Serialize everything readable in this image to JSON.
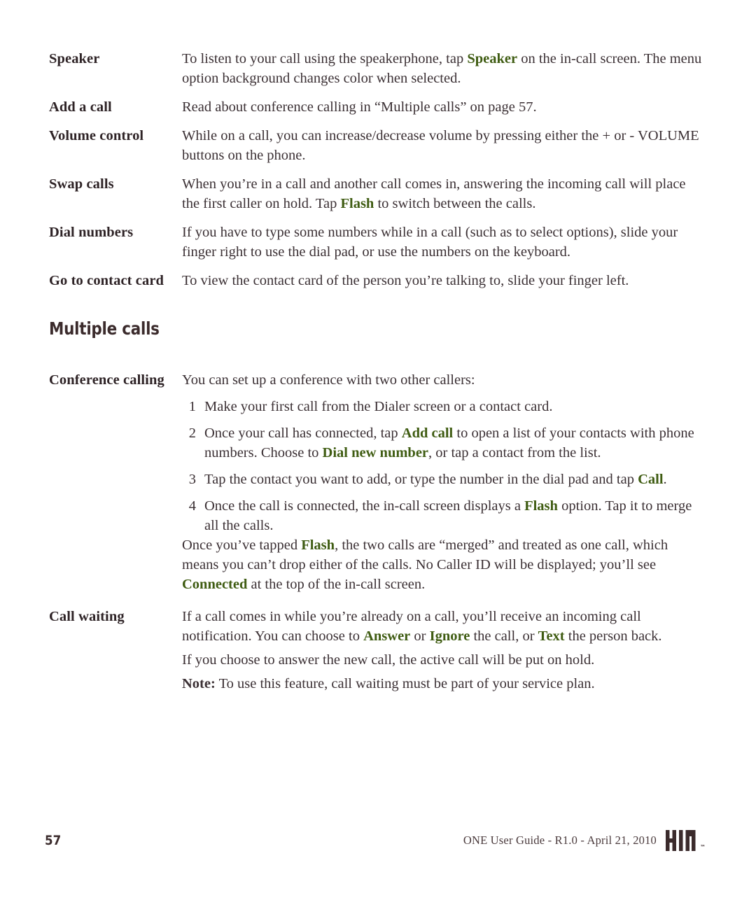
{
  "document": {
    "colors": {
      "body_text": "#3b3034",
      "label_text": "#2e2326",
      "accent_green": "#3f5c12",
      "heading": "#3b2b2c",
      "background": "#ffffff"
    }
  },
  "entries": [
    {
      "label": "Speaker",
      "lines": [
        {
          "segments": [
            {
              "text": "To listen to your call using the speakerphone, tap ",
              "style": "normal"
            },
            {
              "text": "Speaker",
              "style": "green"
            },
            {
              "text": " on the in-call screen. The menu option background changes color when selected.",
              "style": "normal"
            }
          ]
        }
      ]
    },
    {
      "label": "Add a call",
      "lines": [
        {
          "segments": [
            {
              "text": "Read about conference calling in “Multiple calls” on page 57.",
              "style": "normal"
            }
          ]
        }
      ]
    },
    {
      "label": "Volume control",
      "lines": [
        {
          "segments": [
            {
              "text": "While on a call, you can increase/decrease volume by pressing either the + or - VOLUME buttons on the phone.",
              "style": "normal"
            }
          ]
        }
      ]
    },
    {
      "label": "Swap calls",
      "lines": [
        {
          "segments": [
            {
              "text": "When you’re in a call and another call comes in, answering the incoming call will place the first caller on hold. Tap ",
              "style": "normal"
            },
            {
              "text": "Flash",
              "style": "green"
            },
            {
              "text": " to switch between the calls.",
              "style": "normal"
            }
          ]
        }
      ]
    },
    {
      "label": "Dial numbers",
      "lines": [
        {
          "segments": [
            {
              "text": "If you have to type some numbers while in a call (such as to select options), slide your finger right to use the dial pad, or use the numbers on the keyboard.",
              "style": "normal"
            }
          ]
        }
      ]
    },
    {
      "label": "Go to contact card",
      "lines": [
        {
          "segments": [
            {
              "text": "To view the contact card of the person you’re talking to, slide your finger left.",
              "style": "normal"
            }
          ]
        }
      ]
    }
  ],
  "section": {
    "heading": "Multiple calls",
    "conference": {
      "label": "Conference calling",
      "intro": "You can set up a conference with two other callers:",
      "steps": [
        {
          "number": "1",
          "segments": [
            {
              "text": "Make your first call from the Dialer screen or a contact card.",
              "style": "normal"
            }
          ]
        },
        {
          "number": "2",
          "segments": [
            {
              "text": "Once your call has connected, tap ",
              "style": "normal"
            },
            {
              "text": "Add call",
              "style": "green"
            },
            {
              "text": " to open a list of your contacts with phone numbers. Choose to ",
              "style": "normal"
            },
            {
              "text": "Dial new number",
              "style": "green"
            },
            {
              "text": ", or tap a contact from the list.",
              "style": "normal"
            }
          ]
        },
        {
          "number": "3",
          "segments": [
            {
              "text": "Tap the contact you want to add, or type the number in the dial pad and tap ",
              "style": "normal"
            },
            {
              "text": "Call",
              "style": "green"
            },
            {
              "text": ".",
              "style": "normal"
            }
          ]
        },
        {
          "number": "4",
          "segments": [
            {
              "text": "Once the call is connected, the in-call screen displays a ",
              "style": "normal"
            },
            {
              "text": "Flash",
              "style": "green"
            },
            {
              "text": " option. Tap it to merge all the calls.",
              "style": "normal"
            }
          ]
        }
      ],
      "closing": [
        {
          "text": "Once you’ve tapped ",
          "style": "normal"
        },
        {
          "text": "Flash",
          "style": "green"
        },
        {
          "text": ", the two calls are “merged” and treated as one call, which means you can’t drop either of the calls. No Caller ID will be displayed; you’ll see ",
          "style": "normal"
        },
        {
          "text": "Connected",
          "style": "green"
        },
        {
          "text": " at the top of the in-call screen.",
          "style": "normal"
        }
      ]
    },
    "call_waiting": {
      "label": "Call waiting",
      "paragraphs": [
        [
          {
            "text": "If a call comes in while you’re already on a call, you’ll receive an incoming call notification. You can choose to ",
            "style": "normal"
          },
          {
            "text": "Answer",
            "style": "green"
          },
          {
            "text": " or ",
            "style": "normal"
          },
          {
            "text": "Ignore",
            "style": "green"
          },
          {
            "text": " the call, or ",
            "style": "normal"
          },
          {
            "text": "Text",
            "style": "green"
          },
          {
            "text": " the person back.",
            "style": "normal"
          }
        ],
        [
          {
            "text": "If you choose to answer the new call, the active call will be put on hold.",
            "style": "normal"
          }
        ],
        [
          {
            "text": "Note:",
            "style": "bold"
          },
          {
            "text": " To use this feature, call waiting must be part of your service plan.",
            "style": "normal"
          }
        ]
      ]
    }
  },
  "footer": {
    "page_number": "57",
    "guide_text": "ONE User Guide - R1.0 - April 21, 2010",
    "logo_name": "KIN",
    "logo_tm": "™"
  }
}
